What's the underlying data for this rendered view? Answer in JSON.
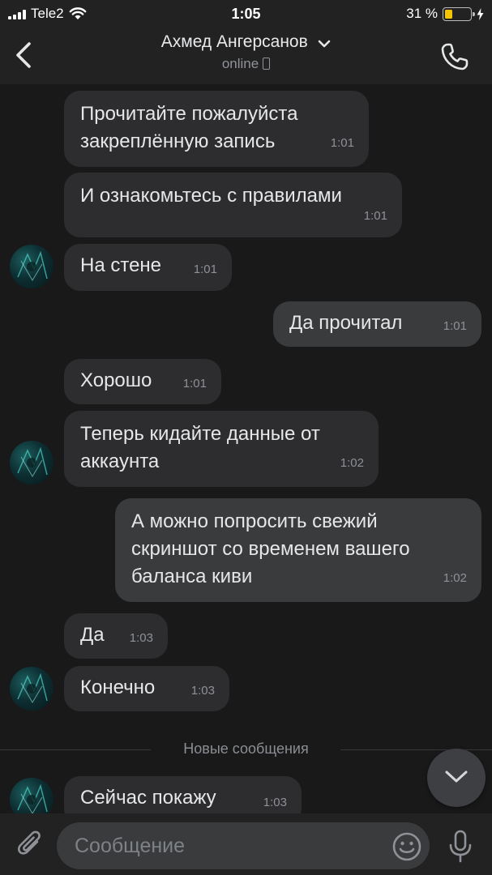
{
  "status_bar": {
    "carrier": "Tele2",
    "time": "1:05",
    "battery_text": "31 %",
    "battery_level": 0.31
  },
  "header": {
    "contact_name": "Ахмед Ангерсанов",
    "status": "online",
    "icons": [
      "back-icon",
      "chevron-down-icon",
      "mobile-icon",
      "phone-icon"
    ]
  },
  "messages": [
    {
      "direction": "in",
      "lines": [
        "Прочитайте пожалуйста",
        "закреплённую запись"
      ],
      "time": "1:01",
      "avatar": false
    },
    {
      "direction": "in",
      "lines": [
        "И ознакомьтесь с правилами"
      ],
      "time": "1:01",
      "avatar": false
    },
    {
      "direction": "in",
      "lines": [
        "На стене"
      ],
      "time": "1:01",
      "avatar": true
    },
    {
      "direction": "out",
      "lines": [
        "Да прочитал"
      ],
      "time": "1:01"
    },
    {
      "direction": "in",
      "lines": [
        "Хорошо"
      ],
      "time": "1:01",
      "avatar": false
    },
    {
      "direction": "in",
      "lines": [
        "Теперь кидайте данные от",
        "аккаунта"
      ],
      "time": "1:02",
      "avatar": true
    },
    {
      "direction": "out",
      "lines": [
        "А можно попросить свежий",
        "скриншот со временем вашего",
        "баланса киви"
      ],
      "time": "1:02"
    },
    {
      "direction": "in",
      "lines": [
        "Да"
      ],
      "time": "1:03",
      "avatar": false
    },
    {
      "direction": "in",
      "lines": [
        "Конечно"
      ],
      "time": "1:03",
      "avatar": true
    },
    {
      "direction": "in",
      "lines": [
        "Сейчас покажу"
      ],
      "time": "1:03",
      "avatar": true
    }
  ],
  "new_messages_label": "Новые сообщения",
  "composer": {
    "placeholder": "Сообщение",
    "icons": [
      "paperclip-icon",
      "emoji-icon",
      "microphone-icon"
    ]
  },
  "colors": {
    "background": "#19191a",
    "bar": "#222223",
    "bubble_in": "#2d2d2f",
    "bubble_out": "#3a3b3d",
    "battery_fill": "#f5c400"
  }
}
